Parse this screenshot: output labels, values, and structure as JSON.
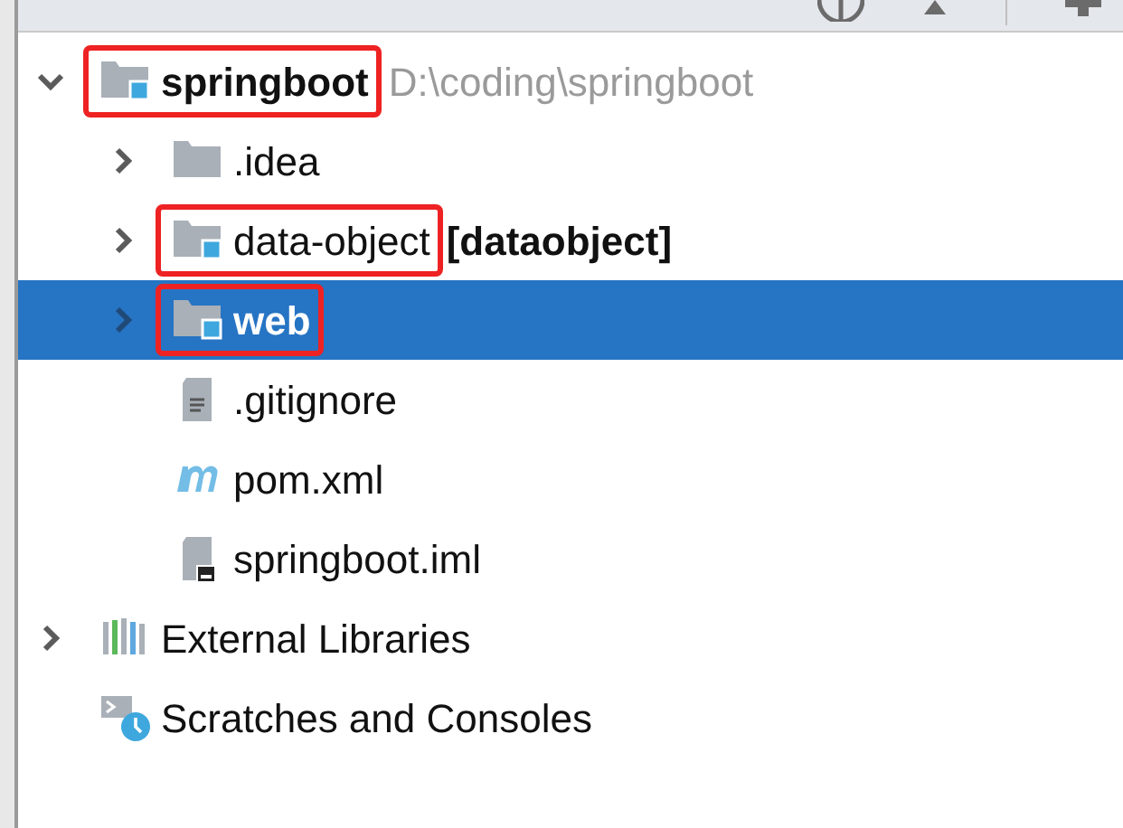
{
  "tree": [
    {
      "kind": "module",
      "name": "springboot",
      "bold": true,
      "path": "D:\\coding\\springboot",
      "expanded": true,
      "highlighted": true,
      "selected": false,
      "children": [
        {
          "kind": "folder",
          "name": ".idea",
          "bold": false,
          "expanded": false,
          "highlighted": false,
          "selected": false
        },
        {
          "kind": "module",
          "name": "data-object",
          "bold": false,
          "module_label": "[dataobject]",
          "expanded": false,
          "highlighted": true,
          "selected": false
        },
        {
          "kind": "module",
          "name": "web",
          "bold": true,
          "expanded": false,
          "highlighted": true,
          "selected": true
        },
        {
          "kind": "text-file",
          "name": ".gitignore",
          "bold": false,
          "highlighted": false,
          "selected": false
        },
        {
          "kind": "maven",
          "name": "pom.xml",
          "bold": false,
          "highlighted": false,
          "selected": false
        },
        {
          "kind": "iml",
          "name": "springboot.iml",
          "bold": false,
          "highlighted": false,
          "selected": false
        }
      ]
    },
    {
      "kind": "libraries",
      "name": "External Libraries",
      "bold": false,
      "expanded": false,
      "highlighted": false,
      "selected": false
    },
    {
      "kind": "scratches",
      "name": "Scratches and Consoles",
      "bold": false,
      "highlighted": false,
      "selected": false
    }
  ]
}
